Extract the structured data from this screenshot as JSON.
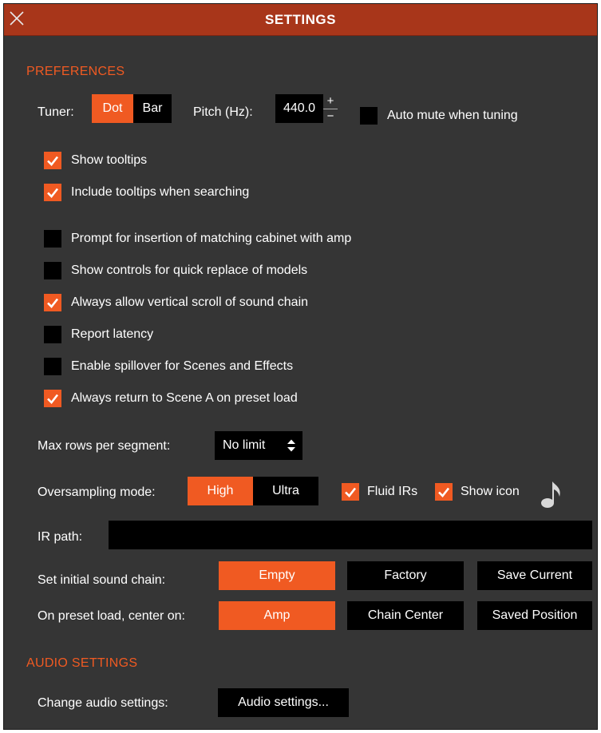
{
  "window": {
    "title": "SETTINGS"
  },
  "preferences": {
    "section_title": "PREFERENCES",
    "tuner": {
      "label": "Tuner:",
      "options": [
        "Dot",
        "Bar"
      ],
      "selected": "Dot"
    },
    "pitch": {
      "label": "Pitch (Hz):",
      "value": "440.0",
      "plus": "+",
      "minus": "−"
    },
    "auto_mute": {
      "label": "Auto mute when tuning",
      "checked": false
    },
    "checkboxes": [
      {
        "label": "Show tooltips",
        "checked": true
      },
      {
        "label": "Include tooltips when searching",
        "checked": true
      },
      {
        "label": "Prompt for insertion of matching cabinet with amp",
        "checked": false
      },
      {
        "label": "Show controls for quick replace of models",
        "checked": false
      },
      {
        "label": "Always allow vertical scroll of sound chain",
        "checked": true
      },
      {
        "label": "Report latency",
        "checked": false
      },
      {
        "label": "Enable spillover for Scenes and Effects",
        "checked": false
      },
      {
        "label": "Always return to Scene A on preset load",
        "checked": true
      }
    ],
    "max_rows": {
      "label": "Max rows per segment:",
      "value": "No limit"
    },
    "oversampling": {
      "label": "Oversampling mode:",
      "options": [
        "High",
        "Ultra"
      ],
      "selected": "High"
    },
    "fluid_irs": {
      "label": "Fluid IRs",
      "checked": true
    },
    "show_icon": {
      "label": "Show icon",
      "checked": true
    },
    "ir_path": {
      "label": "IR path:",
      "value": ""
    },
    "initial_chain": {
      "label": "Set initial sound chain:",
      "options": [
        "Empty",
        "Factory",
        "Save Current"
      ],
      "selected": "Empty"
    },
    "center_on": {
      "label": "On preset load, center on:",
      "options": [
        "Amp",
        "Chain Center",
        "Saved Position"
      ],
      "selected": "Amp"
    }
  },
  "audio": {
    "section_title": "AUDIO SETTINGS",
    "change_label": "Change audio settings:",
    "button_label": "Audio settings..."
  },
  "colors": {
    "accent": "#f05a22",
    "titlebar": "#a8361a",
    "panel": "#353535",
    "control": "#000000"
  }
}
